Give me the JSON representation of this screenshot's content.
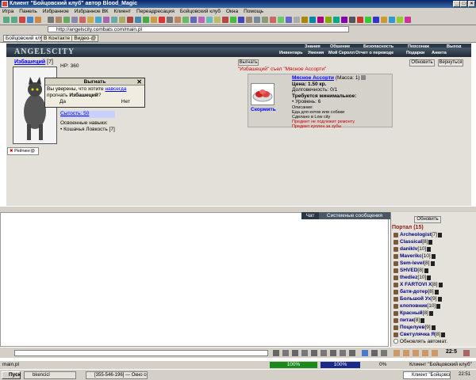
{
  "window": {
    "title": "Клиент \"Бойцовский клуб\" автор Blood_Magic"
  },
  "menu": [
    "Игра",
    "Панель",
    "Избранное",
    "Избранное ВК",
    "Клиент",
    "Переадресация",
    "Бойцовский клуб",
    "Окна",
    "Помощь"
  ],
  "address": {
    "url": "http://angelscity.combats.com/main.pl"
  },
  "tabs": [
    "Бойцовский клуб",
    "В Контакте | Видео-@"
  ],
  "game": {
    "logo": "ANGELSCITY",
    "nav_top": [
      "Знания",
      "Общение",
      "Безопасность",
      "Персонаж",
      "Выход"
    ],
    "nav_sub": [
      "Инвентарь",
      "Умения",
      "Мой Скролл",
      "Отчет о переводе",
      "Подарки",
      "Анкета"
    ],
    "player": {
      "name": "Избашеций",
      "level": "[7]",
      "hp": "HP: 360",
      "satiety": "Сытость: 50",
      "skills_title": "Освоенные навыки:",
      "skill": "• Кошачья Ловкость [7]",
      "rating": "Рейтинг@"
    },
    "dialog": {
      "title": "Выгнать",
      "line1a": "Вы уверены, что хотите ",
      "line1b": "навсегда",
      "line2": "прогнать ",
      "name": "Избашеций",
      "q": "?",
      "yes": "Да",
      "no": "Нет"
    },
    "kick_button": "Выгнать",
    "refresh_button": "Обновить",
    "back_button": "Вернуться",
    "event_msg": "\"Избашеций\" съел \"Мясное Ассорти\"",
    "item": {
      "name": "Мясное Ассорти",
      "mass": "(Масса: 1)",
      "price": "Цена: 1.50 кр.",
      "durability": "Долговечность: 0/1",
      "req_title": "Требуется минимальное:",
      "req_level": "• Уровень: 6",
      "desc_title": "Описание:",
      "desc1": "Еда для котов или собаки",
      "desc2": "Сделано в Low city",
      "warn1": "Предмет не подлежит ремонту",
      "warn2": "Предмет куплен за зубы",
      "feed": "Скормить"
    }
  },
  "chat": {
    "tab_chat": "Чат",
    "tab_system": "Системные сообщения"
  },
  "right": {
    "refresh": "Обновить",
    "location": "Портал",
    "count": "(15)",
    "players": [
      {
        "name": "Archeologist",
        "lvl": "[7]"
      },
      {
        "name": "Classical",
        "lvl": "[8]"
      },
      {
        "name": "daniklv",
        "lvl": "[10]"
      },
      {
        "name": "Maverikc",
        "lvl": "[10]"
      },
      {
        "name": "Sem-level",
        "lvl": "[8]"
      },
      {
        "name": "SHVED",
        "lvl": "[8]"
      },
      {
        "name": "thediez",
        "lvl": "[10]"
      },
      {
        "name": "X FARTOVI X",
        "lvl": "[8]"
      },
      {
        "name": "батя-дотер",
        "lvl": "[8]"
      },
      {
        "name": "Большой Ух",
        "lvl": "[9]"
      },
      {
        "name": "клоповник",
        "lvl": "[10]"
      },
      {
        "name": "Красный",
        "lvl": "[8]"
      },
      {
        "name": "питак",
        "lvl": "[8]"
      },
      {
        "name": "Поцелуев",
        "lvl": "[9]"
      },
      {
        "name": "Светулячка Я",
        "lvl": "[8]"
      }
    ],
    "auto_refresh": "Обновлять автомат."
  },
  "clock": {
    "time": "22:5"
  },
  "status": {
    "left": "main.pl",
    "p1": "100%",
    "p2": "100%",
    "p3": "0%",
    "right": "Клиент \"Бойцовский клуб\""
  },
  "taskbar": {
    "start": "Пуск",
    "items": [
      "bkencicl",
      "[355-546-196] — Окно со...",
      "Клиент \"Бойцовский клуб\"..."
    ],
    "time": "22:51"
  }
}
